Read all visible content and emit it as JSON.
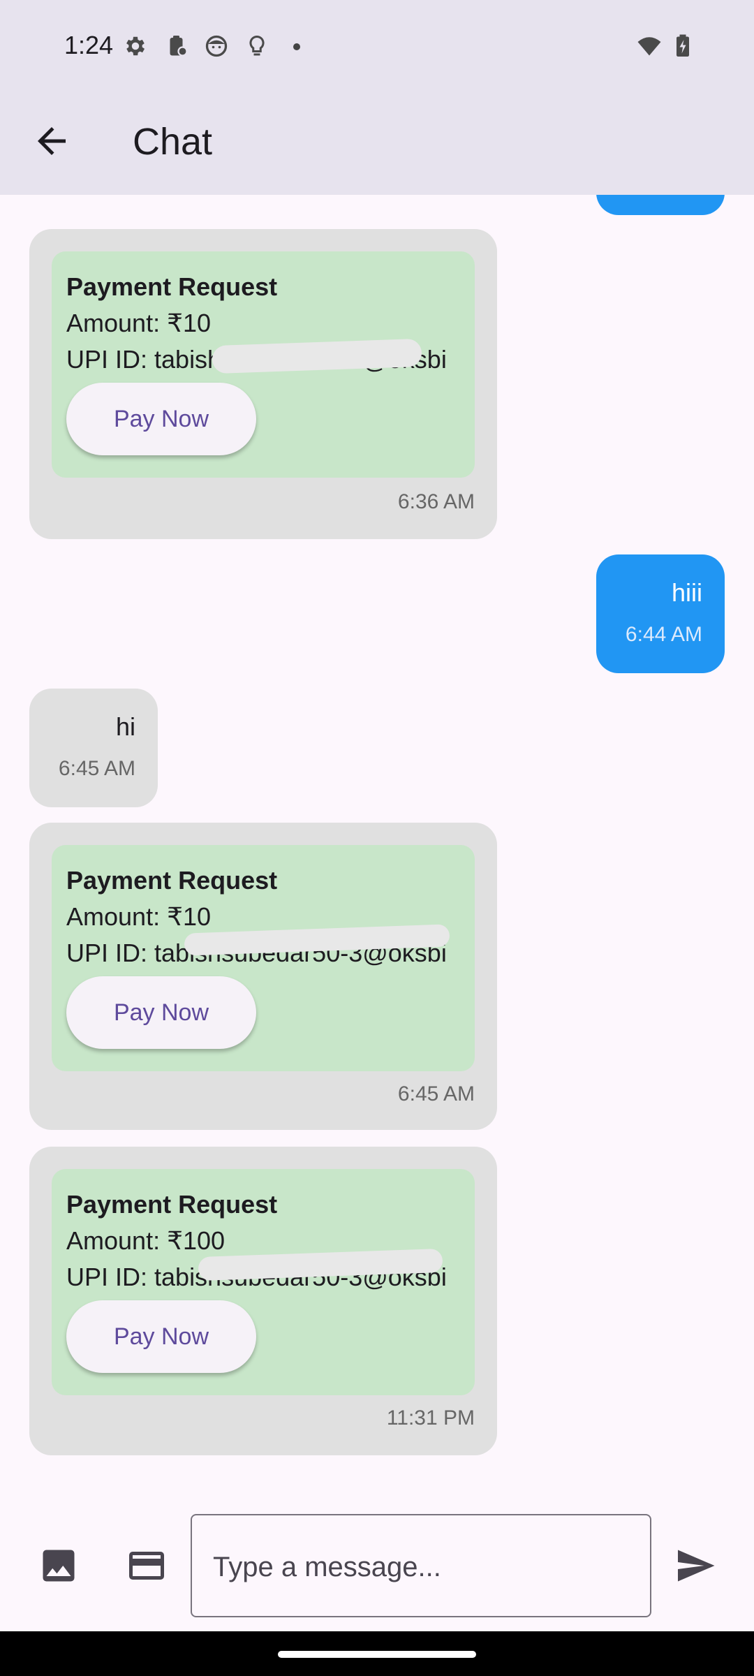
{
  "status_bar": {
    "time": "1:24",
    "icons": [
      "settings-icon",
      "clipboard-icon",
      "face-icon",
      "lightbulb-icon",
      "dot-icon",
      "wifi-icon",
      "battery-charging-icon"
    ]
  },
  "app_bar": {
    "title": "Chat",
    "back_icon": "arrow-back-icon"
  },
  "messages": [
    {
      "type": "payment",
      "title": "Payment Request",
      "amount": "Amount: ₹10",
      "upi": "UPI ID: tabishsubedar50-3@oksbi",
      "button": "Pay Now",
      "time": "6:36 AM"
    },
    {
      "type": "sent",
      "text": "hiii",
      "time": "6:44 AM"
    },
    {
      "type": "received",
      "text": "hi",
      "time": "6:45 AM"
    },
    {
      "type": "payment",
      "title": "Payment Request",
      "amount": "Amount: ₹10",
      "upi": "UPI ID: tabishsubedar50-3@oksbi",
      "button": "Pay Now",
      "time": "6:45 AM"
    },
    {
      "type": "payment",
      "title": "Payment Request",
      "amount": "Amount: ₹100",
      "upi": "UPI ID: tabishsubedar50-3@oksbi",
      "button": "Pay Now",
      "time": "11:31 PM"
    }
  ],
  "input_bar": {
    "image_icon": "image-icon",
    "card_icon": "credit-card-icon",
    "placeholder": "Type a message...",
    "send_icon": "send-icon"
  },
  "colors": {
    "sent_bubble": "#2196f3",
    "received_bubble": "#e0e0e0",
    "payment_card": "#c8e6c9",
    "pay_button_text": "#5e4a9c"
  }
}
